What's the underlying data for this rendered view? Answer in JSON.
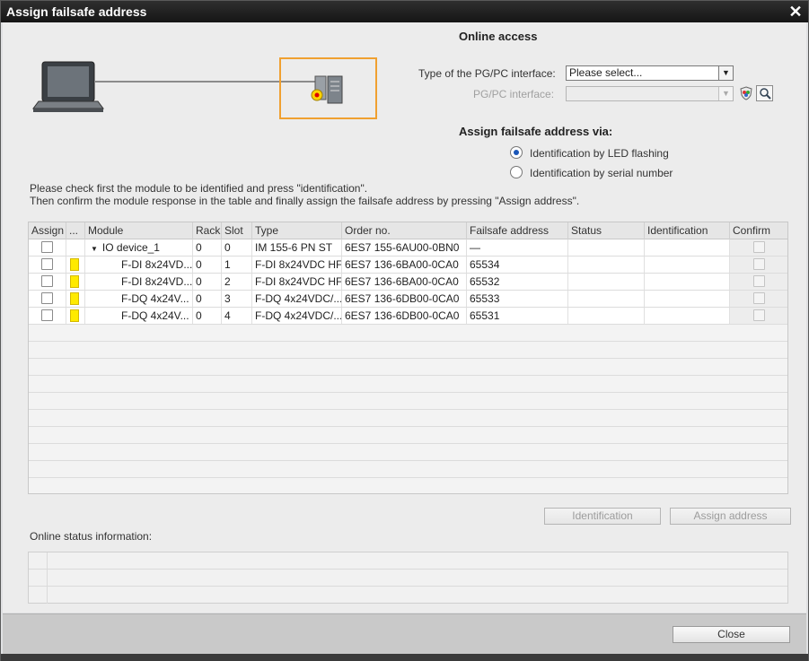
{
  "window": {
    "title": "Assign failsafe address"
  },
  "online_access": {
    "heading": "Online access",
    "interface_type_label": "Type of the PG/PC interface:",
    "interface_type_value": "Please select...",
    "interface_label": "PG/PC interface:",
    "interface_value": ""
  },
  "assign_via": {
    "heading": "Assign failsafe address via:",
    "options": [
      {
        "label": "Identification by LED flashing",
        "checked": true
      },
      {
        "label": "Identification by serial number",
        "checked": false
      }
    ]
  },
  "instructions": {
    "line1": "Please check first the module to be identified and press \"identification\".",
    "line2": "Then confirm the module response in the table and finally assign the failsafe address by pressing \"Assign address\"."
  },
  "table": {
    "columns": [
      "Assign",
      "...",
      "Module",
      "Rack",
      "Slot",
      "Type",
      "Order no.",
      "Failsafe address",
      "Status",
      "Identification",
      "Confirm"
    ],
    "rows": [
      {
        "module": "IO device_1",
        "expanded": true,
        "has_swatch": false,
        "rack": "0",
        "slot": "0",
        "type": "IM 155-6 PN ST",
        "order_no": "6ES7 155-6AU00-0BN0",
        "failsafe_address": "—"
      },
      {
        "module": "F-DI 8x24VD...",
        "has_swatch": true,
        "rack": "0",
        "slot": "1",
        "type": "F-DI 8x24VDC HF",
        "order_no": "6ES7 136-6BA00-0CA0",
        "failsafe_address": "65534"
      },
      {
        "module": "F-DI 8x24VD...",
        "has_swatch": true,
        "rack": "0",
        "slot": "2",
        "type": "F-DI 8x24VDC HF",
        "order_no": "6ES7 136-6BA00-0CA0",
        "failsafe_address": "65532"
      },
      {
        "module": "F-DQ 4x24V...",
        "has_swatch": true,
        "rack": "0",
        "slot": "3",
        "type": "F-DQ 4x24VDC/...",
        "order_no": "6ES7 136-6DB00-0CA0",
        "failsafe_address": "65533"
      },
      {
        "module": "F-DQ 4x24V...",
        "has_swatch": true,
        "rack": "0",
        "slot": "4",
        "type": "F-DQ 4x24VDC/...",
        "order_no": "6ES7 136-6DB00-0CA0",
        "failsafe_address": "65531"
      }
    ]
  },
  "buttons": {
    "identification": "Identification",
    "assign_address": "Assign address",
    "close": "Close"
  },
  "status": {
    "label": "Online status information:"
  },
  "colors": {
    "titlebar": "#1f1f1f",
    "highlight_frame": "#f0a030",
    "swatch": "#ffea00",
    "radio_dot": "#1a56b8"
  },
  "icons": [
    "laptop-icon",
    "io-device-icon",
    "shield-icon",
    "search-icon",
    "expand-arrow-icon"
  ]
}
